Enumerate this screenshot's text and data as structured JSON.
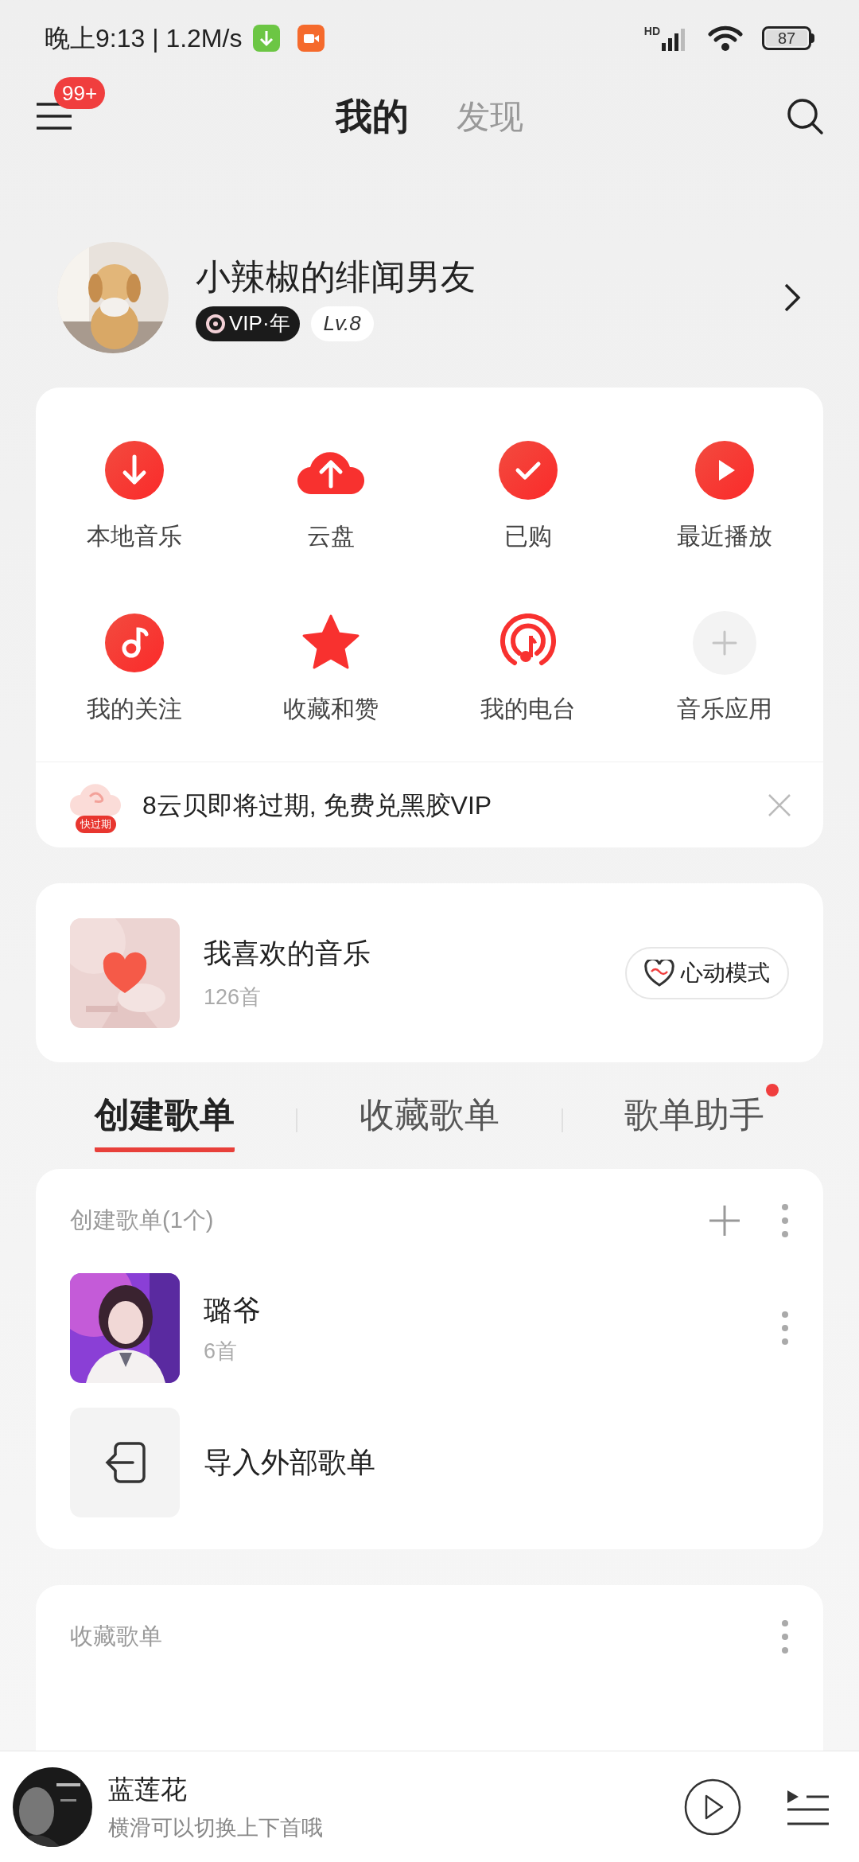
{
  "status_bar": {
    "time": "晚上9:13 | 1.2M/s",
    "network": "HD",
    "battery": "87"
  },
  "header": {
    "menu_badge": "99+",
    "tabs": [
      {
        "label": "我的",
        "selected": true
      },
      {
        "label": "发现",
        "selected": false
      }
    ]
  },
  "profile": {
    "name": "小辣椒的绯闻男友",
    "vip_badge": "VIP·年",
    "level": "Lv.8"
  },
  "shortcuts": [
    {
      "label": "本地音乐",
      "kind": "download"
    },
    {
      "label": "云盘",
      "kind": "cloud"
    },
    {
      "label": "已购",
      "kind": "check"
    },
    {
      "label": "最近播放",
      "kind": "play"
    },
    {
      "label": "我的关注",
      "kind": "note"
    },
    {
      "label": "收藏和赞",
      "kind": "star"
    },
    {
      "label": "我的电台",
      "kind": "radio"
    },
    {
      "label": "音乐应用",
      "kind": "add"
    }
  ],
  "notice": {
    "badge": "快过期",
    "text": "8云贝即将过期, 免费兑黑胶VIP"
  },
  "liked": {
    "title": "我喜欢的音乐",
    "count": "126首",
    "button": "心动模式"
  },
  "playlist_tabs": [
    {
      "label": "创建歌单",
      "selected": true,
      "dot": false
    },
    {
      "label": "收藏歌单",
      "selected": false,
      "dot": false
    },
    {
      "label": "歌单助手",
      "selected": false,
      "dot": true
    }
  ],
  "created": {
    "header": "创建歌单(1个)",
    "playlists": [
      {
        "name": "璐爷",
        "count": "6首"
      }
    ],
    "import": "导入外部歌单"
  },
  "collected": {
    "header": "收藏歌单"
  },
  "player": {
    "title": "蓝莲花",
    "subtitle": "横滑可以切换上下首哦"
  }
}
